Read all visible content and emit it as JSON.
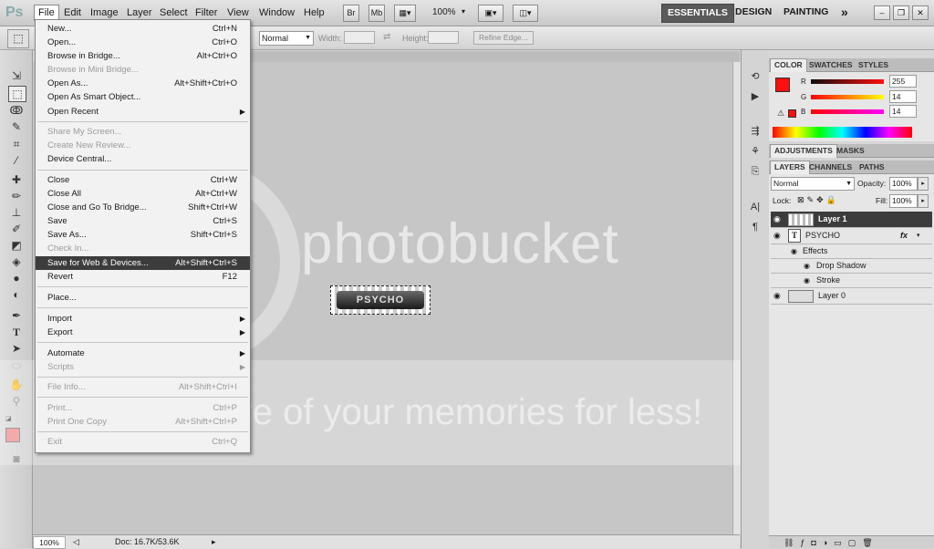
{
  "app": {
    "logo": "Ps"
  },
  "menubar": {
    "menus": [
      "File",
      "Edit",
      "Image",
      "Layer",
      "Select",
      "Filter",
      "View",
      "Window",
      "Help"
    ],
    "bridge": "Br",
    "minibridge": "Mb",
    "zoom": "100%",
    "workspaces": [
      "ESSENTIALS",
      "DESIGN",
      "PAINTING"
    ],
    "more": "»"
  },
  "options": {
    "style_value": "Normal",
    "width_label": "Width:",
    "height_label": "Height:",
    "refine_edge": "Refine Edge..."
  },
  "file_menu": {
    "items": [
      {
        "label": "New...",
        "shortcut": "Ctrl+N"
      },
      {
        "label": "Open...",
        "shortcut": "Ctrl+O"
      },
      {
        "label": "Browse in Bridge...",
        "shortcut": "Alt+Ctrl+O"
      },
      {
        "label": "Browse in Mini Bridge...",
        "shortcut": ""
      },
      {
        "label": "Open As...",
        "shortcut": "Alt+Shift+Ctrl+O"
      },
      {
        "label": "Open As Smart Object...",
        "shortcut": ""
      },
      {
        "label": "Open Recent",
        "shortcut": ""
      },
      {
        "label": "Share My Screen...",
        "shortcut": ""
      },
      {
        "label": "Create New Review...",
        "shortcut": ""
      },
      {
        "label": "Device Central...",
        "shortcut": ""
      },
      {
        "label": "Close",
        "shortcut": "Ctrl+W"
      },
      {
        "label": "Close All",
        "shortcut": "Alt+Ctrl+W"
      },
      {
        "label": "Close and Go To Bridge...",
        "shortcut": "Shift+Ctrl+W"
      },
      {
        "label": "Save",
        "shortcut": "Ctrl+S"
      },
      {
        "label": "Save As...",
        "shortcut": "Shift+Ctrl+S"
      },
      {
        "label": "Check In...",
        "shortcut": ""
      },
      {
        "label": "Save for Web & Devices...",
        "shortcut": "Alt+Shift+Ctrl+S"
      },
      {
        "label": "Revert",
        "shortcut": "F12"
      },
      {
        "label": "Place...",
        "shortcut": ""
      },
      {
        "label": "Import",
        "shortcut": ""
      },
      {
        "label": "Export",
        "shortcut": ""
      },
      {
        "label": "Automate",
        "shortcut": ""
      },
      {
        "label": "Scripts",
        "shortcut": ""
      },
      {
        "label": "File Info...",
        "shortcut": "Alt+Shift+Ctrl+I"
      },
      {
        "label": "Print...",
        "shortcut": "Ctrl+P"
      },
      {
        "label": "Print One Copy",
        "shortcut": "Alt+Shift+Ctrl+P"
      },
      {
        "label": "Exit",
        "shortcut": "Ctrl+Q"
      }
    ]
  },
  "status": {
    "zoom": "100%",
    "doc": "Doc: 16.7K/53.6K"
  },
  "canvas": {
    "logo_text": "PSYCHO"
  },
  "watermark": {
    "line1": "photobucket",
    "line2": "Protect more of your memories for less!"
  },
  "color_panel": {
    "tabs": [
      "COLOR",
      "SWATCHES",
      "STYLES"
    ],
    "r_label": "R",
    "r_value": "255",
    "g_label": "G",
    "g_value": "14",
    "b_label": "B",
    "b_value": "14"
  },
  "adjust_panel": {
    "tabs": [
      "ADJUSTMENTS",
      "MASKS"
    ]
  },
  "layers_panel": {
    "tabs": [
      "LAYERS",
      "CHANNELS",
      "PATHS"
    ],
    "blend_mode": "Normal",
    "opacity_label": "Opacity:",
    "opacity_value": "100%",
    "lock_label": "Lock:",
    "fill_label": "Fill:",
    "fill_value": "100%",
    "layers": [
      {
        "name": "Layer 1"
      },
      {
        "name": "PSYCHO"
      },
      {
        "name": "Effects"
      },
      {
        "name": "Drop Shadow"
      },
      {
        "name": "Stroke"
      },
      {
        "name": "Layer 0"
      }
    ],
    "fx": "fx"
  },
  "colors": {
    "foreground": "#ff0e0e",
    "accent_dark": "#3c3c3c"
  }
}
